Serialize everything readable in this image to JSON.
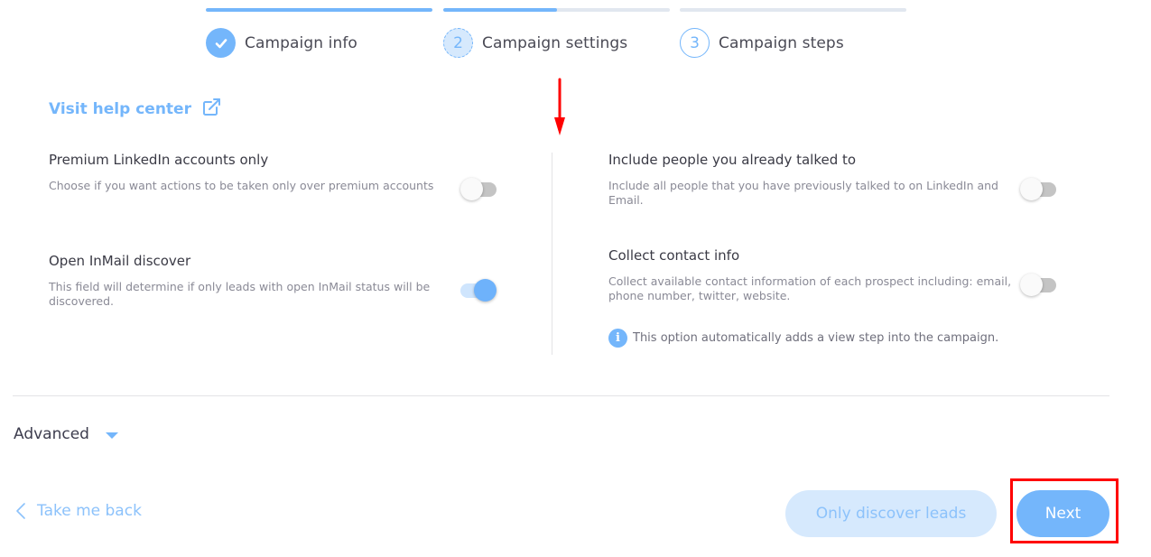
{
  "stepper": {
    "steps": [
      {
        "number": "1",
        "label": "Campaign info",
        "state": "done",
        "progress": 1.0
      },
      {
        "number": "2",
        "label": "Campaign settings",
        "state": "current",
        "progress": 0.5
      },
      {
        "number": "3",
        "label": "Campaign steps",
        "state": "todo",
        "progress": 0.0
      }
    ]
  },
  "help": {
    "label": "Visit help center",
    "icon": "external-link-icon"
  },
  "settings": {
    "premium_only": {
      "title": "Premium LinkedIn accounts only",
      "description": "Choose if you want actions to be taken only over premium accounts",
      "enabled": false
    },
    "open_inmail": {
      "title": "Open InMail discover",
      "description": "This field will determine if only leads with open InMail status will be discovered.",
      "enabled": true
    },
    "include_talked": {
      "title": "Include people you already talked to",
      "description": "Include all people that you have previously talked to on LinkedIn and Email.",
      "enabled": false
    },
    "collect_contact": {
      "title": "Collect contact info",
      "description": "Collect available contact information of each prospect including: email, phone number, twitter, website.",
      "enabled": false
    },
    "info_note": "This option automatically adds a view step into the campaign.",
    "info_icon_glyph": "i"
  },
  "advanced": {
    "label": "Advanced"
  },
  "footer": {
    "back_label": "Take me back",
    "secondary_label": "Only discover leads",
    "primary_label": "Next"
  },
  "colors": {
    "accent": "#74b6fb",
    "accent_light": "#d6e9fd",
    "annotation": "#ff0000"
  }
}
